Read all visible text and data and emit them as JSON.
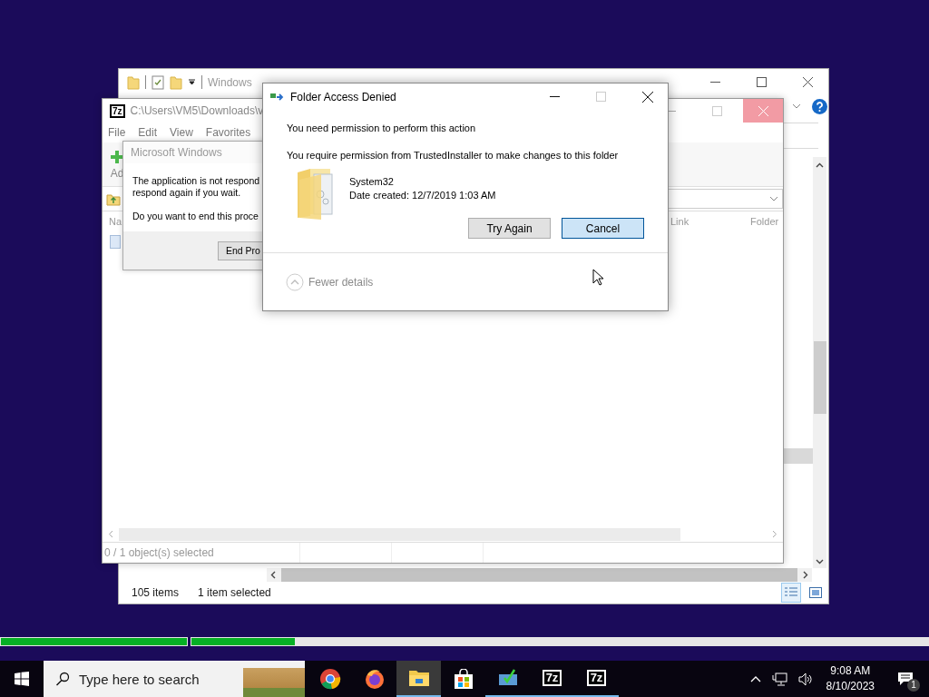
{
  "explorer_window": {
    "title": "Windows",
    "status": {
      "item_count": "105 items",
      "selection": "1 item selected"
    }
  },
  "archive_window": {
    "icon_label": "7z",
    "title": "C:\\Users\\VM5\\Downloads\\v",
    "menu": [
      "File",
      "Edit",
      "View",
      "Favorites"
    ],
    "add_label": "Ad",
    "columns": [
      "Na",
      "Link",
      "Folder"
    ],
    "status": "0 / 1 object(s) selected"
  },
  "not_responding_dialog": {
    "title": "Microsoft Windows",
    "message_lines": [
      "The application is not respond",
      "respond again if you wait."
    ],
    "question": "Do you want to end this proce",
    "button": "End Pro"
  },
  "access_dialog": {
    "title": "Folder Access Denied",
    "heading": "You need permission to perform this action",
    "message": "You require permission from TrustedInstaller to make changes to this folder",
    "folder": {
      "name": "System32",
      "date": "Date created: 12/7/2019 1:03 AM"
    },
    "buttons": [
      {
        "label": "Try Again",
        "selected": false
      },
      {
        "label": "Cancel",
        "selected": true
      }
    ],
    "details_toggle": "Fewer details"
  },
  "progress_bars": [
    {
      "level": 1
    },
    {
      "level": 0.14
    }
  ],
  "taskbar": {
    "search_placeholder": "Type here to search",
    "apps": [
      {
        "kind": "chrome",
        "open": false,
        "active": false
      },
      {
        "kind": "firefox",
        "open": false,
        "active": false
      },
      {
        "kind": "explorer",
        "open": true,
        "active": true
      },
      {
        "kind": "store",
        "open": false,
        "active": false
      },
      {
        "kind": "monitor",
        "open": true,
        "active": false
      },
      {
        "kind": "archiver",
        "label": "7z",
        "open": true,
        "active": false
      },
      {
        "kind": "archiver",
        "label": "7z",
        "open": true,
        "active": false
      }
    ],
    "time": "9:08 AM",
    "date": "8/10/2023",
    "notification_count": "1"
  }
}
